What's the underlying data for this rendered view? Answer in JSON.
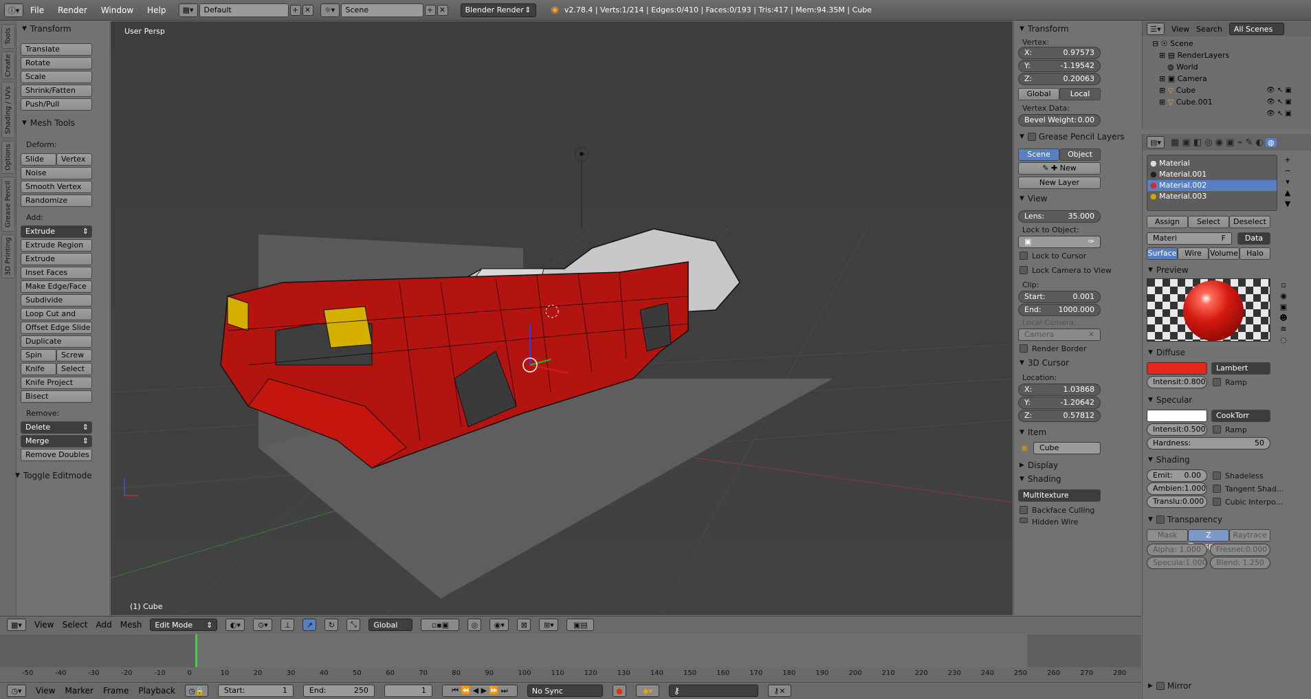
{
  "topbar": {
    "menus": [
      "File",
      "Render",
      "Window",
      "Help"
    ],
    "screen_layout": "Default",
    "scene": "Scene",
    "engine": "Blender Render",
    "stats": "v2.78.4 | Verts:1/214 | Edges:0/410 | Faces:0/193 | Tris:417 | Mem:94.35M | Cube"
  },
  "vtabs": [
    "Tools",
    "Create",
    "Shading / UVs",
    "Options",
    "Grease Pencil",
    "3D Printing"
  ],
  "toolshelf": {
    "transform_title": "Transform",
    "transform": [
      "Translate",
      "Rotate",
      "Scale",
      "Shrink/Fatten",
      "Push/Pull"
    ],
    "mesh_title": "Mesh Tools",
    "deform_label": "Deform:",
    "slide_edge": "Slide Ed",
    "vertex": "Vertex",
    "deform": [
      "Noise",
      "Smooth Vertex",
      "Randomize"
    ],
    "add_label": "Add:",
    "extrude": "Extrude",
    "add": [
      "Extrude Region",
      "Extrude Individual",
      "Inset Faces",
      "Make Edge/Face",
      "Subdivide",
      "Loop Cut and Slide",
      "Offset Edge Slide",
      "Duplicate"
    ],
    "spin": "Spin",
    "screw": "Screw",
    "knife": "Knife",
    "select": "Select",
    "knife_project": "Knife Project",
    "bisect": "Bisect",
    "remove_label": "Remove:",
    "delete": "Delete",
    "merge": "Merge",
    "remove_doubles": "Remove Doubles",
    "toggle": "Toggle Editmode"
  },
  "viewport": {
    "view_label": "User Persp",
    "object_label": "(1) Cube"
  },
  "npanel": {
    "transform": "Transform",
    "vertex": "Vertex:",
    "x_l": "X:",
    "x": "0.97573",
    "y_l": "Y:",
    "y": "-1.19542",
    "z_l": "Z:",
    "z": "0.20063",
    "global": "Global",
    "local": "Local",
    "vertex_data": "Vertex Data:",
    "bevel_l": "Bevel Weight:",
    "bevel": "0.00",
    "gp": "Grease Pencil Layers",
    "scene": "Scene",
    "object": "Object",
    "new": "New",
    "new_layer": "New Layer",
    "view": "View",
    "lens_l": "Lens:",
    "lens": "35.000",
    "lock_obj": "Lock to Object:",
    "lock_cursor": "Lock to Cursor",
    "lock_cam": "Lock Camera to View",
    "clip": "Clip:",
    "start_l": "Start:",
    "start": "0.001",
    "end_l": "End:",
    "end": "1000.000",
    "local_cam": "Local Camera:",
    "camera": "Camera",
    "render_border": "Render Border",
    "cursor": "3D Cursor",
    "location": "Location:",
    "cx": "1.03868",
    "cy": "-1.20642",
    "cz": "0.57812",
    "item": "Item",
    "item_name": "Cube",
    "display": "Display",
    "shading": "Shading",
    "multitexture": "Multitexture",
    "backface": "Backface Culling",
    "hidden_wire": "Hidden Wire"
  },
  "outliner": {
    "view": "View",
    "search": "Search",
    "filter": "All Scenes",
    "items": [
      "Scene",
      "RenderLayers",
      "World",
      "Camera",
      "Cube",
      "Cube.001"
    ]
  },
  "props": {
    "materials": [
      "Material",
      "Material.001",
      "Material.002",
      "Material.003"
    ],
    "assign": "Assign",
    "select": "Select",
    "deselect": "Deselect",
    "mat_name": "Materi",
    "f": "F",
    "data": "Data",
    "tabs": [
      "Surface",
      "Wire",
      "Volume",
      "Halo"
    ],
    "preview": "Preview",
    "diffuse": "Diffuse",
    "lambert": "Lambert",
    "intens_l": "Intensit:",
    "d_int": "0.800",
    "ramp": "Ramp",
    "specular": "Specular",
    "cooktorr": "CookTorr",
    "s_int": "0.500",
    "hardness_l": "Hardness:",
    "hardness": "50",
    "shading": "Shading",
    "emit_l": "Emit:",
    "emit": "0.00",
    "shadeless": "Shadeless",
    "ambient_l": "Ambien:",
    "ambient": "1.000",
    "tangent": "Tangent Shad...",
    "transl_l": "Translu:",
    "transl": "0.000",
    "cubic": "Cubic Interpo...",
    "transparency": "Transparency",
    "mask": "Mask",
    "ztransp": "Z Transpare...",
    "raytrace": "Raytrace",
    "alpha_l": "Alpha:",
    "alpha": "1.000",
    "fresnel_l": "Fresnel:",
    "fresnel": "0.000",
    "specula_l": "Specula:",
    "specula": "1.000",
    "blend_l": "Blend:",
    "blend": "1.250",
    "mirror": "Mirror"
  },
  "vpheader": {
    "menus": [
      "View",
      "Select",
      "Add",
      "Mesh"
    ],
    "mode": "Edit Mode",
    "orientation": "Global"
  },
  "timeline": {
    "ticks": [
      "-50",
      "-40",
      "-30",
      "-20",
      "-10",
      "0",
      "10",
      "20",
      "30",
      "40",
      "50",
      "60",
      "70",
      "80",
      "90",
      "100",
      "110",
      "120",
      "130",
      "140",
      "150",
      "160",
      "170",
      "180",
      "190",
      "200",
      "210",
      "220",
      "230",
      "240",
      "250",
      "260",
      "270",
      "280"
    ]
  },
  "tlheader": {
    "menus": [
      "View",
      "Marker",
      "Frame",
      "Playback"
    ],
    "start_l": "Start:",
    "start": "1",
    "end_l": "End:",
    "end": "250",
    "current": "1",
    "sync": "No Sync"
  },
  "colors": {
    "accent": "#5680c2",
    "material_red": "#e5261a"
  }
}
